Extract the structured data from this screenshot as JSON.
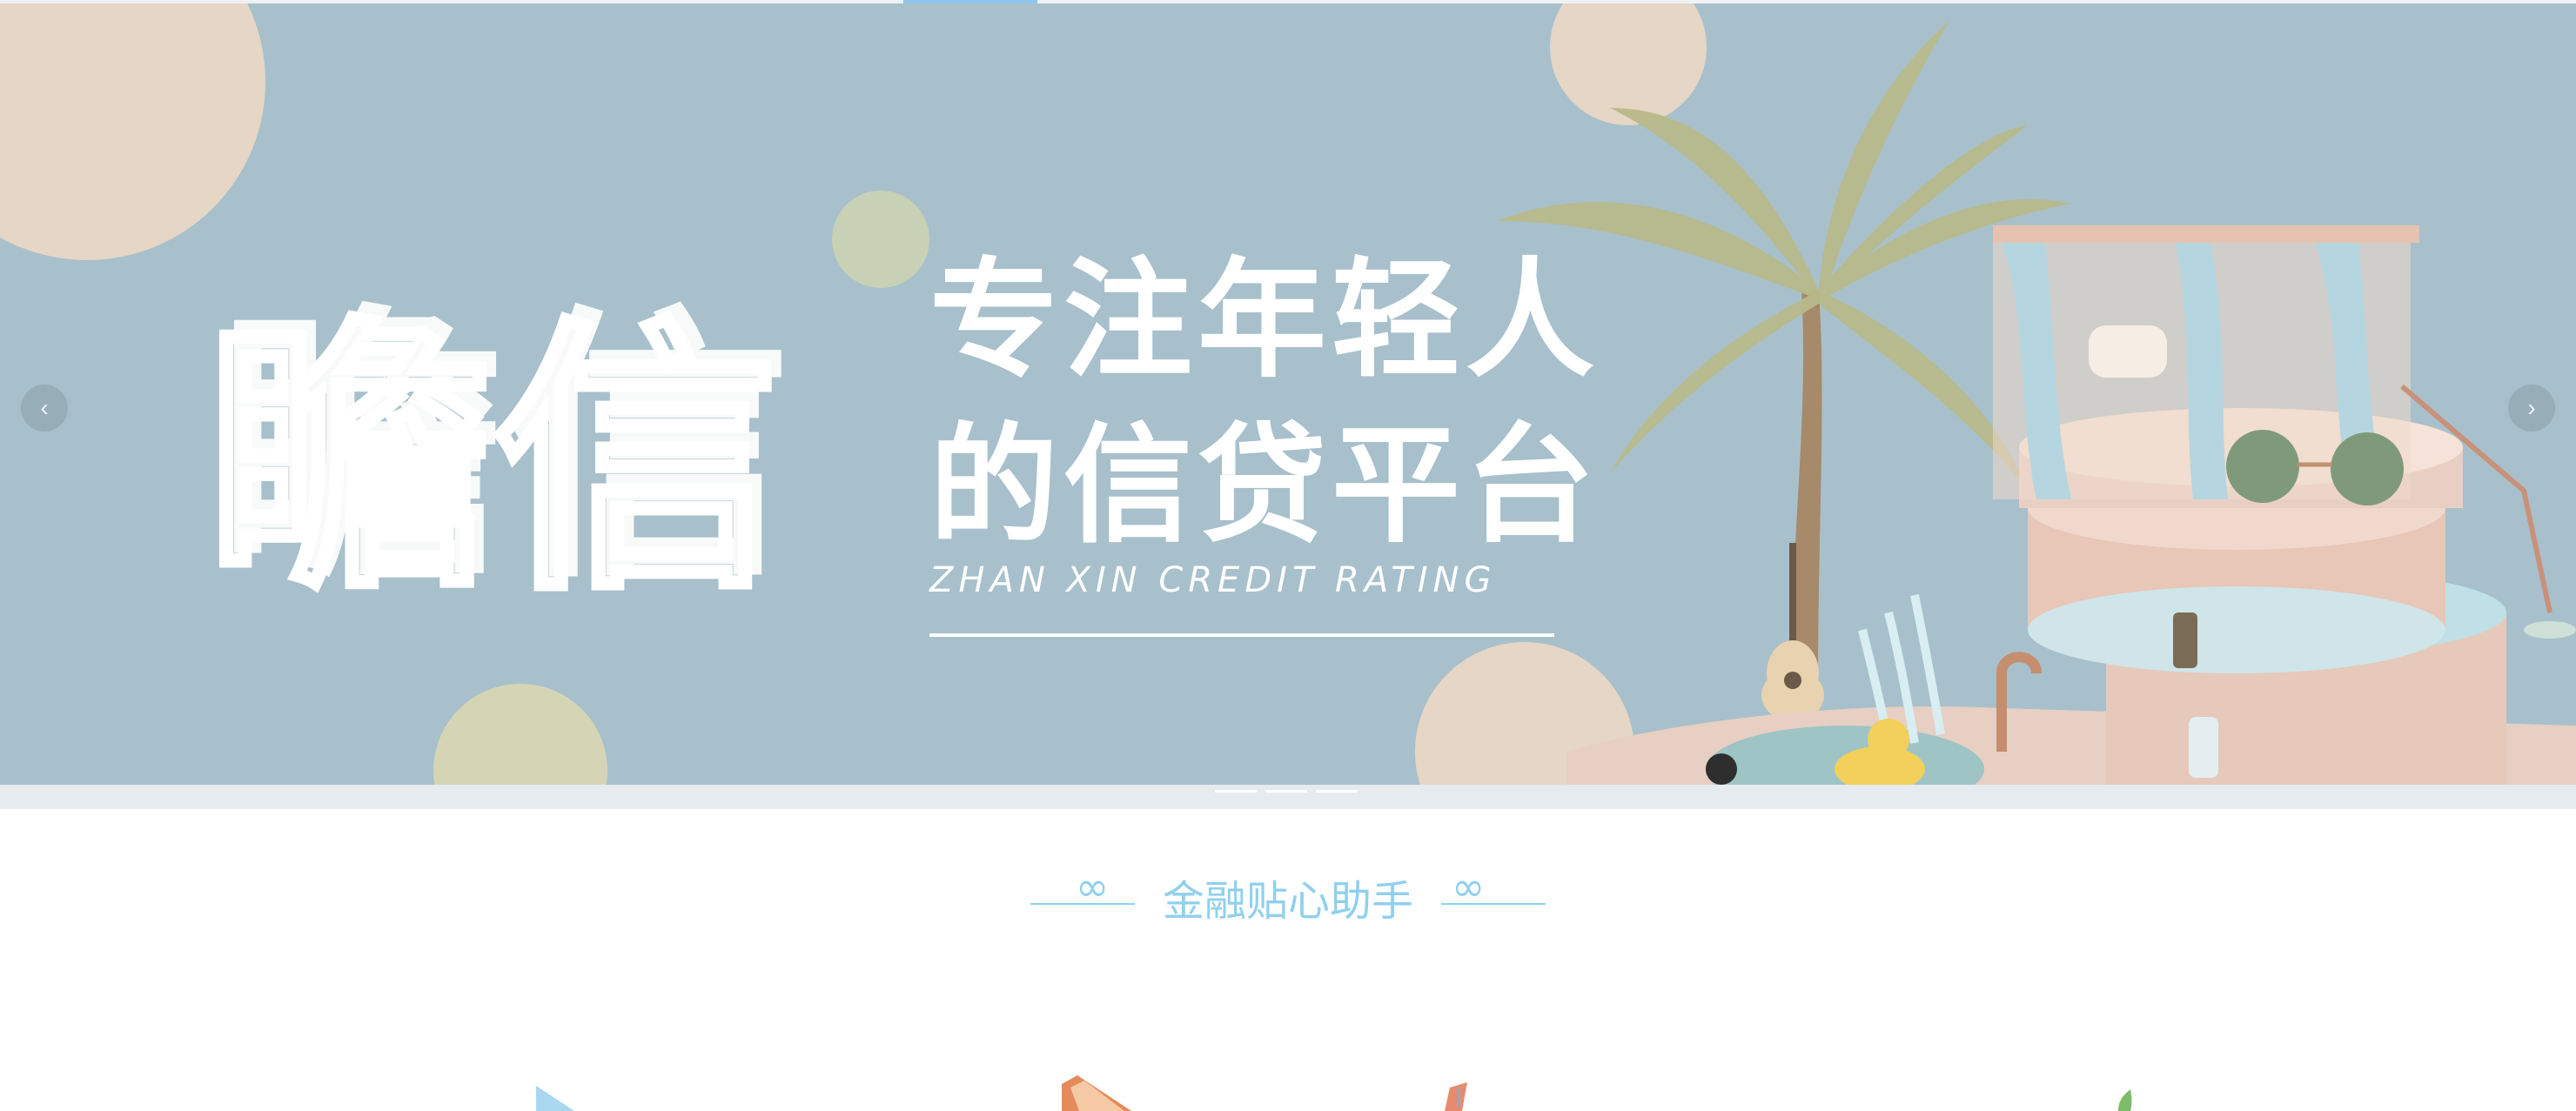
{
  "banner": {
    "brand_chars": "瞻信",
    "headline_line1": "专注年轻人",
    "headline_line2": "的信贷平台",
    "tagline": "ZHAN XIN CREDIT RATING"
  },
  "carousel": {
    "prev_icon": "‹",
    "next_icon": "›"
  },
  "section": {
    "title": "金融贴心助手",
    "left_deco": "∞",
    "right_deco": "∞"
  },
  "colors": {
    "banner_bg": "#a8c0cb",
    "accent": "#8fd0ef",
    "peach_circle": "#e6d6c6",
    "sage_circle": "#c8d1b6"
  }
}
